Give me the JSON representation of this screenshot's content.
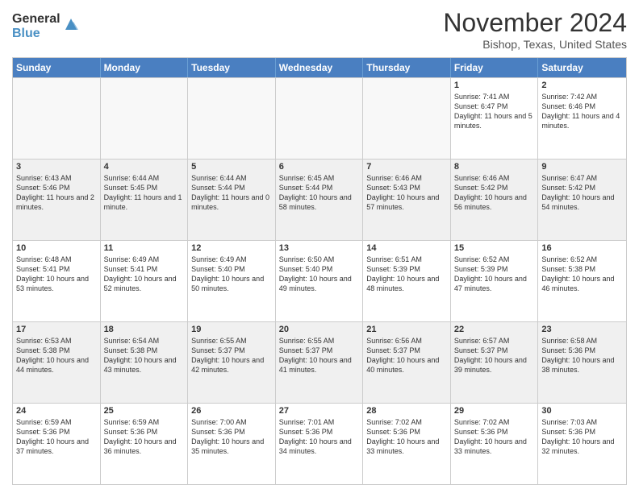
{
  "logo": {
    "general": "General",
    "blue": "Blue"
  },
  "title": "November 2024",
  "location": "Bishop, Texas, United States",
  "days": [
    "Sunday",
    "Monday",
    "Tuesday",
    "Wednesday",
    "Thursday",
    "Friday",
    "Saturday"
  ],
  "rows": [
    [
      {
        "day": "",
        "text": ""
      },
      {
        "day": "",
        "text": ""
      },
      {
        "day": "",
        "text": ""
      },
      {
        "day": "",
        "text": ""
      },
      {
        "day": "",
        "text": ""
      },
      {
        "day": "1",
        "text": "Sunrise: 7:41 AM\nSunset: 6:47 PM\nDaylight: 11 hours and 5 minutes."
      },
      {
        "day": "2",
        "text": "Sunrise: 7:42 AM\nSunset: 6:46 PM\nDaylight: 11 hours and 4 minutes."
      }
    ],
    [
      {
        "day": "3",
        "text": "Sunrise: 6:43 AM\nSunset: 5:46 PM\nDaylight: 11 hours and 2 minutes."
      },
      {
        "day": "4",
        "text": "Sunrise: 6:44 AM\nSunset: 5:45 PM\nDaylight: 11 hours and 1 minute."
      },
      {
        "day": "5",
        "text": "Sunrise: 6:44 AM\nSunset: 5:44 PM\nDaylight: 11 hours and 0 minutes."
      },
      {
        "day": "6",
        "text": "Sunrise: 6:45 AM\nSunset: 5:44 PM\nDaylight: 10 hours and 58 minutes."
      },
      {
        "day": "7",
        "text": "Sunrise: 6:46 AM\nSunset: 5:43 PM\nDaylight: 10 hours and 57 minutes."
      },
      {
        "day": "8",
        "text": "Sunrise: 6:46 AM\nSunset: 5:42 PM\nDaylight: 10 hours and 56 minutes."
      },
      {
        "day": "9",
        "text": "Sunrise: 6:47 AM\nSunset: 5:42 PM\nDaylight: 10 hours and 54 minutes."
      }
    ],
    [
      {
        "day": "10",
        "text": "Sunrise: 6:48 AM\nSunset: 5:41 PM\nDaylight: 10 hours and 53 minutes."
      },
      {
        "day": "11",
        "text": "Sunrise: 6:49 AM\nSunset: 5:41 PM\nDaylight: 10 hours and 52 minutes."
      },
      {
        "day": "12",
        "text": "Sunrise: 6:49 AM\nSunset: 5:40 PM\nDaylight: 10 hours and 50 minutes."
      },
      {
        "day": "13",
        "text": "Sunrise: 6:50 AM\nSunset: 5:40 PM\nDaylight: 10 hours and 49 minutes."
      },
      {
        "day": "14",
        "text": "Sunrise: 6:51 AM\nSunset: 5:39 PM\nDaylight: 10 hours and 48 minutes."
      },
      {
        "day": "15",
        "text": "Sunrise: 6:52 AM\nSunset: 5:39 PM\nDaylight: 10 hours and 47 minutes."
      },
      {
        "day": "16",
        "text": "Sunrise: 6:52 AM\nSunset: 5:38 PM\nDaylight: 10 hours and 46 minutes."
      }
    ],
    [
      {
        "day": "17",
        "text": "Sunrise: 6:53 AM\nSunset: 5:38 PM\nDaylight: 10 hours and 44 minutes."
      },
      {
        "day": "18",
        "text": "Sunrise: 6:54 AM\nSunset: 5:38 PM\nDaylight: 10 hours and 43 minutes."
      },
      {
        "day": "19",
        "text": "Sunrise: 6:55 AM\nSunset: 5:37 PM\nDaylight: 10 hours and 42 minutes."
      },
      {
        "day": "20",
        "text": "Sunrise: 6:55 AM\nSunset: 5:37 PM\nDaylight: 10 hours and 41 minutes."
      },
      {
        "day": "21",
        "text": "Sunrise: 6:56 AM\nSunset: 5:37 PM\nDaylight: 10 hours and 40 minutes."
      },
      {
        "day": "22",
        "text": "Sunrise: 6:57 AM\nSunset: 5:37 PM\nDaylight: 10 hours and 39 minutes."
      },
      {
        "day": "23",
        "text": "Sunrise: 6:58 AM\nSunset: 5:36 PM\nDaylight: 10 hours and 38 minutes."
      }
    ],
    [
      {
        "day": "24",
        "text": "Sunrise: 6:59 AM\nSunset: 5:36 PM\nDaylight: 10 hours and 37 minutes."
      },
      {
        "day": "25",
        "text": "Sunrise: 6:59 AM\nSunset: 5:36 PM\nDaylight: 10 hours and 36 minutes."
      },
      {
        "day": "26",
        "text": "Sunrise: 7:00 AM\nSunset: 5:36 PM\nDaylight: 10 hours and 35 minutes."
      },
      {
        "day": "27",
        "text": "Sunrise: 7:01 AM\nSunset: 5:36 PM\nDaylight: 10 hours and 34 minutes."
      },
      {
        "day": "28",
        "text": "Sunrise: 7:02 AM\nSunset: 5:36 PM\nDaylight: 10 hours and 33 minutes."
      },
      {
        "day": "29",
        "text": "Sunrise: 7:02 AM\nSunset: 5:36 PM\nDaylight: 10 hours and 33 minutes."
      },
      {
        "day": "30",
        "text": "Sunrise: 7:03 AM\nSunset: 5:36 PM\nDaylight: 10 hours and 32 minutes."
      }
    ]
  ]
}
